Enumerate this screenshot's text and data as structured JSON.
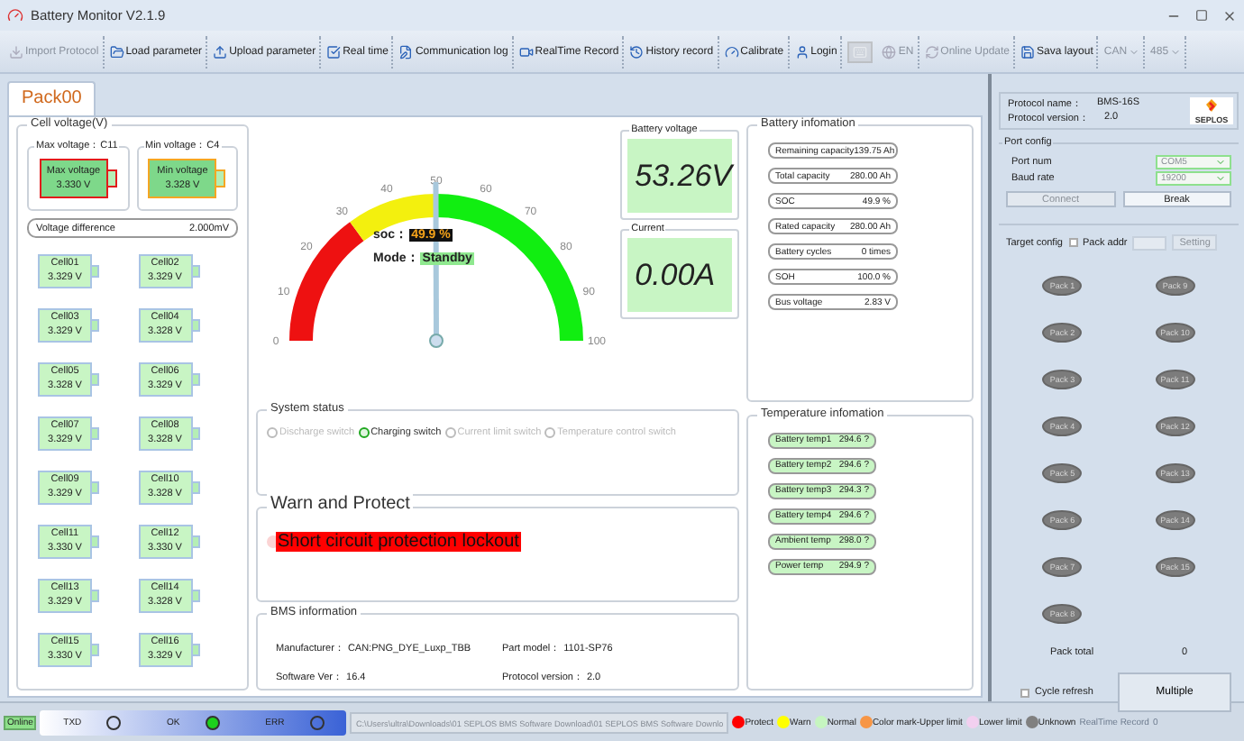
{
  "window": {
    "title": "Battery Monitor V2.1.9"
  },
  "toolbar": [
    {
      "kind": "button",
      "label": "Import Protocol",
      "disabled": true
    },
    {
      "kind": "button",
      "label": "Load parameter",
      "disabled": false
    },
    {
      "kind": "button",
      "label": "Upload parameter",
      "disabled": false
    },
    {
      "kind": "button",
      "label": "Real time",
      "disabled": false
    },
    {
      "kind": "button",
      "label": "Communication log",
      "disabled": false
    },
    {
      "kind": "button",
      "label": "RealTime Record",
      "disabled": false
    },
    {
      "kind": "button",
      "label": "History record",
      "disabled": false
    },
    {
      "kind": "button",
      "label": "Calibrate",
      "disabled": false
    },
    {
      "kind": "button",
      "label": "Login",
      "disabled": false
    },
    {
      "kind": "icon",
      "disabled": true
    },
    {
      "kind": "button",
      "label": "EN",
      "disabled": true
    },
    {
      "kind": "button",
      "label": "Online Update",
      "disabled": true
    },
    {
      "kind": "button",
      "label": "Sava layout",
      "disabled": false
    },
    {
      "kind": "dropdown",
      "label": "CAN",
      "disabled": true
    },
    {
      "kind": "dropdown",
      "label": "485",
      "disabled": true
    }
  ],
  "tabs": [
    {
      "label": "Pack00",
      "selected": true
    }
  ],
  "cell_voltage": {
    "title": "Cell voltage(V)",
    "extremes": [
      {
        "kind": "max",
        "legend": "Max voltage：C11",
        "label": "Max voltage",
        "value": "3.330 V"
      },
      {
        "kind": "min",
        "legend": "Min voltage：C4",
        "label": "Min voltage",
        "value": "3.328 V"
      }
    ],
    "difference": {
      "label": "Voltage difference",
      "value": "2.000mV"
    },
    "cells": [
      {
        "name": "Cell01",
        "value": "3.329 V"
      },
      {
        "name": "Cell02",
        "value": "3.329 V"
      },
      {
        "name": "Cell03",
        "value": "3.329 V"
      },
      {
        "name": "Cell04",
        "value": "3.328 V"
      },
      {
        "name": "Cell05",
        "value": "3.328 V"
      },
      {
        "name": "Cell06",
        "value": "3.329 V"
      },
      {
        "name": "Cell07",
        "value": "3.329 V"
      },
      {
        "name": "Cell08",
        "value": "3.328 V"
      },
      {
        "name": "Cell09",
        "value": "3.329 V"
      },
      {
        "name": "Cell10",
        "value": "3.328 V"
      },
      {
        "name": "Cell11",
        "value": "3.330 V"
      },
      {
        "name": "Cell12",
        "value": "3.330 V"
      },
      {
        "name": "Cell13",
        "value": "3.329 V"
      },
      {
        "name": "Cell14",
        "value": "3.328 V"
      },
      {
        "name": "Cell15",
        "value": "3.330 V"
      },
      {
        "name": "Cell16",
        "value": "3.329 V"
      }
    ]
  },
  "gauge": {
    "ticks": [
      "0",
      "10",
      "20",
      "30",
      "40",
      "50",
      "60",
      "70",
      "80",
      "90",
      "100"
    ],
    "level": 0.499,
    "soc_label": "soc：",
    "soc_value": "49.9 %",
    "mode_label": "Mode：",
    "mode_value": "Standby"
  },
  "battery_voltage": {
    "title": "Battery voltage",
    "value": "53.26V"
  },
  "current": {
    "title": "Current",
    "value": "0.00A"
  },
  "system_status": {
    "title": "System status",
    "switches": [
      {
        "label": "Discharge switch",
        "checked": false
      },
      {
        "label": "Charging switch",
        "checked": true
      },
      {
        "label": "Current limit switch",
        "checked": false
      },
      {
        "label": "Temperature control switch",
        "checked": false
      }
    ]
  },
  "warn_protect": {
    "title": "Warn and Protect",
    "items": [
      "Short circuit protection lockout"
    ]
  },
  "bms_information": {
    "title": "BMS information",
    "fields": [
      {
        "label": "Manufacturer：",
        "value": "CAN:PNG_DYE_Luxp_TBB"
      },
      {
        "label": "Part model：",
        "value": "1101-SP76"
      },
      {
        "label": "Software Ver：",
        "value": "16.4"
      },
      {
        "label": "Protocol version：",
        "value": "2.0"
      }
    ]
  },
  "battery_information": {
    "title": "Battery infomation",
    "rows": [
      {
        "label": "Remaining capacity",
        "value": "139.75 Ah"
      },
      {
        "label": "Total capacity",
        "value": "280.00 Ah"
      },
      {
        "label": "SOC",
        "value": "49.9 %"
      },
      {
        "label": "Rated capacity",
        "value": "280.00 Ah"
      },
      {
        "label": "Battery cycles",
        "value": "0 times"
      },
      {
        "label": "SOH",
        "value": "100.0 %"
      },
      {
        "label": "Bus voltage",
        "value": "2.83 V"
      }
    ]
  },
  "temperature_information": {
    "title": "Temperature infomation",
    "rows": [
      {
        "label": "Battery temp1",
        "value": "294.6 ?"
      },
      {
        "label": "Battery temp2",
        "value": "294.6 ?"
      },
      {
        "label": "Battery temp3",
        "value": "294.3 ?"
      },
      {
        "label": "Battery temp4",
        "value": "294.6 ?"
      },
      {
        "label": "Ambient temp",
        "value": "298.0 ?"
      },
      {
        "label": "Power temp",
        "value": "294.9 ?"
      }
    ]
  },
  "protocol": {
    "name_label": "Protocol name：",
    "name": "BMS-16S",
    "version_label": "Protocol version：",
    "version": "2.0",
    "logo_text": "SEPLOS"
  },
  "port_config": {
    "title": "Port config",
    "port_label": "Port num",
    "port": "COM5",
    "baud_label": "Baud rate",
    "baud": "19200",
    "connect": {
      "label": "Connect",
      "disabled": true
    },
    "break": {
      "label": "Break",
      "disabled": false
    }
  },
  "target_config": {
    "title": "Target config",
    "pack_addr": {
      "label": "Pack addr",
      "checked": false
    },
    "setting": {
      "label": "Setting",
      "disabled": true
    },
    "packs": [
      "Pack 1",
      "Pack 2",
      "Pack 3",
      "Pack 4",
      "Pack 5",
      "Pack 6",
      "Pack 7",
      "Pack 8",
      "Pack 9",
      "Pack 10",
      "Pack 11",
      "Pack 12",
      "Pack 13",
      "Pack 14",
      "Pack 15"
    ],
    "pack_total_label": "Pack total",
    "pack_total": "0",
    "cycle_refresh": {
      "label": "Cycle refresh",
      "checked": false
    },
    "multiple": "Multiple"
  },
  "status_bar": {
    "connection": "Online",
    "indicators": [
      {
        "label": "TXD",
        "on": false
      },
      {
        "label": "OK",
        "on": true
      },
      {
        "label": "ERR",
        "on": false
      }
    ],
    "path": "C:\\Users\\ultra\\Downloads\\01 SEPLOS BMS Software Download\\01 SEPLOS BMS Software Downlo",
    "legend": [
      {
        "label": "Protect",
        "color": "#ff0000"
      },
      {
        "label": "Warn",
        "color": "#ffff00"
      },
      {
        "label": "Normal",
        "color": "#c6f5c0"
      },
      {
        "label": "Color mark-Upper limit",
        "color": "#f79646"
      },
      {
        "label": "Lower limit",
        "color": "#f2d0f0"
      },
      {
        "label": "Unknown",
        "color": "#808080"
      }
    ],
    "record_label": "RealTime Record",
    "record_count": "0"
  }
}
